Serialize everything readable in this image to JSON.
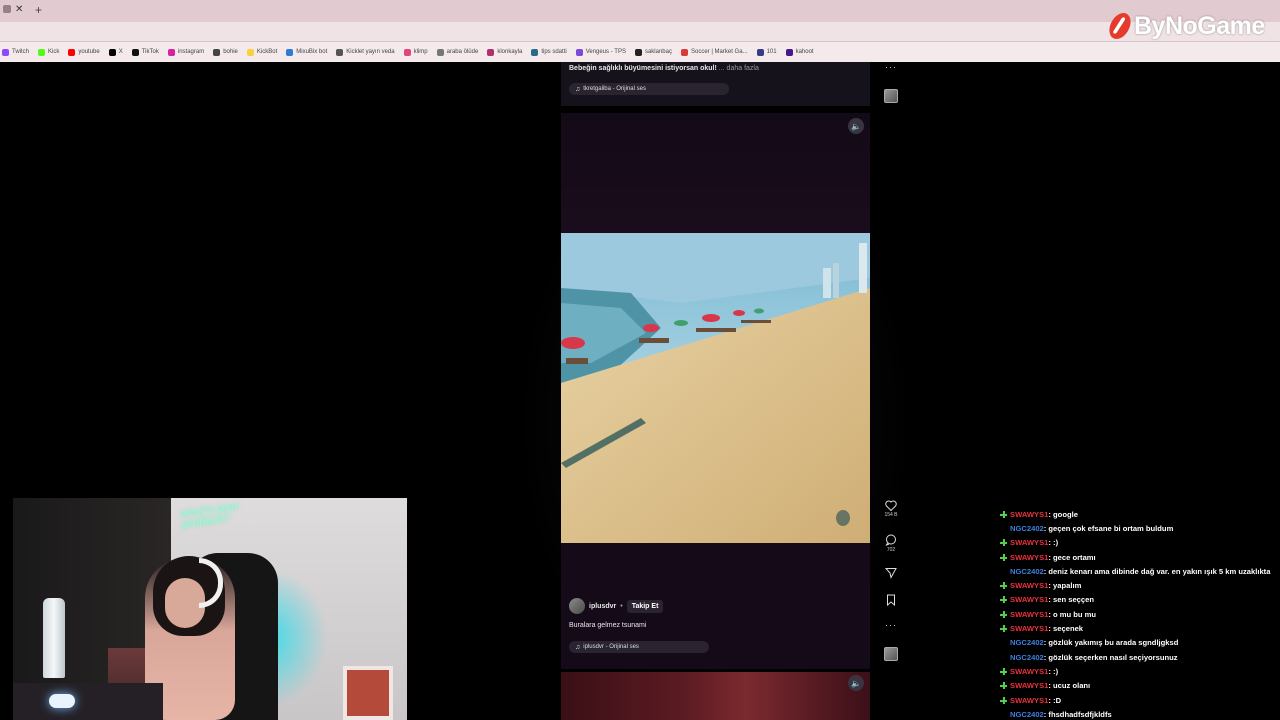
{
  "browser": {
    "tab_close": "✕",
    "tab_new": "+",
    "bookmarks": [
      {
        "label": "Twitch",
        "color": "#9146ff",
        "icon": "twitch-icon"
      },
      {
        "label": "Kick",
        "color": "#53fc18",
        "icon": "kick-icon"
      },
      {
        "label": "youtube",
        "color": "#ff0000",
        "icon": "youtube-icon"
      },
      {
        "label": "X",
        "color": "#000000",
        "icon": "x-icon"
      },
      {
        "label": "TikTok",
        "color": "#111111",
        "icon": "tiktok-icon"
      },
      {
        "label": "instagram",
        "color": "#d6249f",
        "icon": "instagram-icon"
      },
      {
        "label": "bohie",
        "color": "#444444",
        "icon": "globe-icon"
      },
      {
        "label": "KickBot",
        "color": "#f7d23e",
        "icon": "bot-icon"
      },
      {
        "label": "MixuBix bot",
        "color": "#2f7bd8",
        "icon": "bot-icon"
      },
      {
        "label": "Kicklet yayın veda",
        "color": "#555555",
        "icon": "gear-icon"
      },
      {
        "label": "klimp",
        "color": "#e0457b",
        "icon": "star-icon"
      },
      {
        "label": "araba ölüde",
        "color": "#777777",
        "icon": "car-icon"
      },
      {
        "label": "klonkayla",
        "color": "#b0306c",
        "icon": "link-icon"
      },
      {
        "label": "tips sdatti",
        "color": "#2a6a8a",
        "icon": "tips-icon"
      },
      {
        "label": "Vengeus - TPS",
        "color": "#7a4ad8",
        "icon": "game-icon"
      },
      {
        "label": "saklanbaç",
        "color": "#222222",
        "icon": "globe-icon"
      },
      {
        "label": "Soccer | Market Ga...",
        "color": "#d83a3a",
        "icon": "soccer-icon"
      },
      {
        "label": "101",
        "color": "#3a3a8a",
        "icon": "globe-icon"
      },
      {
        "label": "kahoot",
        "color": "#46178f",
        "icon": "kahoot-icon"
      }
    ]
  },
  "logo": {
    "text": "ByNoGame",
    "accent": "#e43b2c"
  },
  "feed": {
    "top_post": {
      "caption": "Bebeğin sağlıklı büyümesini istiyorsan okul!",
      "more": "... daha fazla",
      "audio": "tkretgaliba - Orijinal ses"
    },
    "current_post": {
      "author": "iplusdvr",
      "separator": "•",
      "follow": "Takip Et",
      "caption": "Buralara gelmez tsunami",
      "audio": "iplusdvr - Orijinal ses",
      "likes": "154 B",
      "comments": "702"
    }
  },
  "chat": {
    "colors": {
      "SWAWYS1": "#e8323c",
      "NGC2402": "#3f7fe0"
    },
    "messages": [
      {
        "user": "SWAWYS1",
        "badge": true,
        "text": " : google"
      },
      {
        "user": "NGC2402",
        "badge": false,
        "text": " : geçen çok efsane bi ortam buldum"
      },
      {
        "user": "SWAWYS1",
        "badge": true,
        "text": " : :)"
      },
      {
        "user": "SWAWYS1",
        "badge": true,
        "text": " : gece ortamı"
      },
      {
        "user": "NGC2402",
        "badge": false,
        "text": " : deniz kenarı ama dibinde dağ var. en yakın ışık 5 km uzaklıkta"
      },
      {
        "user": "SWAWYS1",
        "badge": true,
        "text": " : yapalım"
      },
      {
        "user": "SWAWYS1",
        "badge": true,
        "text": " : sen seççen"
      },
      {
        "user": "SWAWYS1",
        "badge": true,
        "text": " : o mu bu mu"
      },
      {
        "user": "SWAWYS1",
        "badge": true,
        "text": " : seçenek"
      },
      {
        "user": "NGC2402",
        "badge": false,
        "text": " : gözlük yakımış bu arada sgndljgksd"
      },
      {
        "user": "NGC2402",
        "badge": false,
        "text": " : gözlük seçerken nasıl seçiyorsunuz"
      },
      {
        "user": "SWAWYS1",
        "badge": true,
        "text": " : :)"
      },
      {
        "user": "SWAWYS1",
        "badge": true,
        "text": " : ucuz olanı"
      },
      {
        "user": "SWAWYS1",
        "badge": true,
        "text": " : :D"
      },
      {
        "user": "NGC2402",
        "badge": false,
        "text": " : fhsdhadfsdfjkldfs"
      }
    ]
  },
  "webcam": {
    "neon_sign": "what's your problem?"
  }
}
